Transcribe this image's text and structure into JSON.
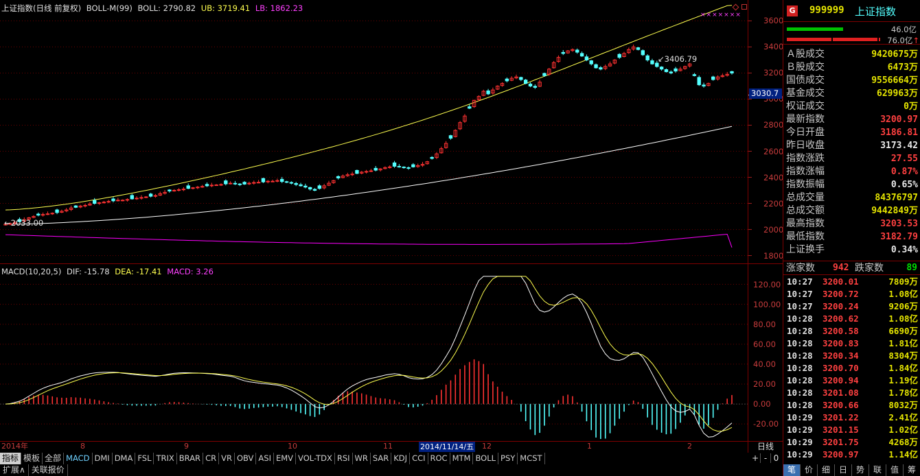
{
  "main_chart": {
    "info": {
      "title": "上证指数(日线 前复权)",
      "indicator": "BOLL-M(99)",
      "boll": "BOLL: 2790.82",
      "ub": "UB: 3719.41",
      "lb": "LB: 1862.23"
    },
    "price_axis_ticks": [
      "3600",
      "3400",
      "3200",
      "3000",
      "2800",
      "2600",
      "2400",
      "2200",
      "2000",
      "1800"
    ],
    "crosshair_price": "3030.7",
    "high_annotation": "3406.79",
    "low_annotation": "2033.00",
    "colors": {
      "up": "#ff3232",
      "down": "#54ffff",
      "mid": "#ffffff",
      "ub": "#ffff4f",
      "lb": "#ff00ff",
      "grid": "#6e0000",
      "axis_text": "#c83c3c"
    }
  },
  "macd_chart": {
    "info": {
      "label": "MACD(10,20,5)",
      "dif": "DIF: -15.78",
      "dea": "DEA: -17.41",
      "macd": "MACD: 3.26"
    },
    "axis_ticks": [
      "120.00",
      "100.00",
      "80.00",
      "60.00",
      "40.00",
      "20.00",
      "0.00",
      "-20.00"
    ]
  },
  "date_axis": {
    "labels": [
      "2014年",
      "8",
      "9",
      "10",
      "11",
      "2014/11/14/五",
      "12",
      "1",
      "2"
    ],
    "period": "日线"
  },
  "indicator_tabs": [
    "指标",
    "模板",
    "全部",
    "MACD",
    "DMI",
    "DMA",
    "FSL",
    "TRIX",
    "BRAR",
    "CR",
    "VR",
    "OBV",
    "ASI",
    "EMV",
    "VOL-TDX",
    "RSI",
    "WR",
    "SAR",
    "KDJ",
    "CCI",
    "ROC",
    "MTM",
    "BOLL",
    "PSY",
    "MCST"
  ],
  "zoom_controls": [
    "+",
    "-",
    "0"
  ],
  "bottom_tabs": [
    "扩展∧",
    "关联报价"
  ],
  "quote_panel": {
    "badge": "G",
    "code": "999999",
    "name": "上证指数",
    "bar1": "46.0亿",
    "bar2": "76.0亿",
    "bar2_arrow": "↑",
    "stats": [
      {
        "label": "Ａ股成交",
        "value": "9420675万",
        "color": "#e5e500"
      },
      {
        "label": "Ｂ股成交",
        "value": "6473万",
        "color": "#e5e500"
      },
      {
        "label": "国债成交",
        "value": "9556664万",
        "color": "#e5e500"
      },
      {
        "label": "基金成交",
        "value": "629963万",
        "color": "#e5e500"
      },
      {
        "label": "权证成交",
        "value": "0万",
        "color": "#e5e500"
      },
      {
        "label": "最新指数",
        "value": "3200.97",
        "color": "#ff4040"
      },
      {
        "label": "今日开盘",
        "value": "3186.81",
        "color": "#ff4040"
      },
      {
        "label": "昨日收盘",
        "value": "3173.42",
        "color": "#e8e8e8"
      },
      {
        "label": "指数涨跌",
        "value": "27.55",
        "color": "#ff4040"
      },
      {
        "label": "指数涨幅",
        "value": "0.87%",
        "color": "#ff4040"
      },
      {
        "label": "指数振幅",
        "value": "0.65%",
        "color": "#e8e8e8"
      },
      {
        "label": "总成交量",
        "value": "84376797",
        "color": "#e5e500"
      },
      {
        "label": "总成交额",
        "value": "9442849万",
        "color": "#e5e500"
      },
      {
        "label": "最高指数",
        "value": "3203.53",
        "color": "#ff4040"
      },
      {
        "label": "最低指数",
        "value": "3182.79",
        "color": "#ff4040"
      },
      {
        "label": "上证换手",
        "value": "0.34%",
        "color": "#e8e8e8"
      }
    ],
    "advance_label": "涨家数",
    "advance_value": "942",
    "decline_label": "跌家数",
    "decline_value": "89",
    "ticks": [
      {
        "time": "10:27",
        "price": "3200.01",
        "vol": "7809万"
      },
      {
        "time": "10:27",
        "price": "3200.72",
        "vol": "1.08亿"
      },
      {
        "time": "10:27",
        "price": "3200.24",
        "vol": "9206万"
      },
      {
        "time": "10:28",
        "price": "3200.62",
        "vol": "1.08亿"
      },
      {
        "time": "10:28",
        "price": "3200.58",
        "vol": "6690万"
      },
      {
        "time": "10:28",
        "price": "3200.83",
        "vol": "1.81亿"
      },
      {
        "time": "10:28",
        "price": "3200.34",
        "vol": "8304万"
      },
      {
        "time": "10:28",
        "price": "3200.70",
        "vol": "1.84亿"
      },
      {
        "time": "10:28",
        "price": "3200.94",
        "vol": "1.19亿"
      },
      {
        "time": "10:28",
        "price": "3201.08",
        "vol": "1.78亿"
      },
      {
        "time": "10:28",
        "price": "3200.66",
        "vol": "8032万"
      },
      {
        "time": "10:29",
        "price": "3201.22",
        "vol": "2.41亿"
      },
      {
        "time": "10:29",
        "price": "3201.15",
        "vol": "1.02亿"
      },
      {
        "time": "10:29",
        "price": "3201.75",
        "vol": "4268万"
      },
      {
        "time": "10:29",
        "price": "3200.97",
        "vol": "1.14亿"
      }
    ],
    "footer_tabs": [
      "笔",
      "价",
      "细",
      "日",
      "势",
      "联",
      "值",
      "筹"
    ]
  },
  "chart_data": [
    {
      "type": "candlestick",
      "title": "上证指数(日线 前复权)",
      "ylim": [
        1740,
        3760
      ],
      "x_start": "2014-07",
      "x_end": "2015-02",
      "close_series": [
        2040,
        2045,
        2055,
        2060,
        2075,
        2090,
        2100,
        2110,
        2115,
        2120,
        2125,
        2130,
        2140,
        2150,
        2165,
        2170,
        2180,
        2185,
        2195,
        2200,
        2205,
        2210,
        2215,
        2220,
        2225,
        2225,
        2230,
        2235,
        2240,
        2245,
        2250,
        2255,
        2260,
        2275,
        2285,
        2295,
        2300,
        2305,
        2310,
        2315,
        2320,
        2325,
        2330,
        2335,
        2340,
        2342,
        2345,
        2350,
        2355,
        2350,
        2345,
        2348,
        2355,
        2360,
        2362,
        2365,
        2370,
        2370,
        2375,
        2368,
        2362,
        2355,
        2345,
        2335,
        2325,
        2310,
        2300,
        2315,
        2335,
        2355,
        2375,
        2395,
        2410,
        2420,
        2425,
        2430,
        2440,
        2445,
        2450,
        2455,
        2465,
        2475,
        2480,
        2485,
        2480,
        2475,
        2470,
        2480,
        2490,
        2500,
        2520,
        2545,
        2580,
        2620,
        2660,
        2700,
        2760,
        2820,
        2870,
        2930,
        2990,
        3020,
        3060,
        3040,
        3070,
        3100,
        3120,
        3140,
        3160,
        3170,
        3150,
        3120,
        3100,
        3090,
        3130,
        3180,
        3230,
        3280,
        3320,
        3350,
        3370,
        3380,
        3360,
        3330,
        3300,
        3270,
        3240,
        3230,
        3250,
        3270,
        3300,
        3320,
        3350,
        3380,
        3400,
        3380,
        3340,
        3300,
        3270,
        3250,
        3230,
        3210,
        3200,
        3215,
        3230,
        3250,
        3270,
        3180,
        3110,
        3100,
        3120,
        3150,
        3170,
        3180,
        3190,
        3200
      ],
      "boll_mid": "2040 → 2790.82",
      "boll_ub": "2150 → 3719.41",
      "boll_lb": "1960 → 1862.23",
      "max_label": 3406.79,
      "min_label": 2033.0
    },
    {
      "type": "line+bar",
      "title": "MACD(10,20,5)",
      "ylim": [
        -35,
        130
      ],
      "dif_last": -15.78,
      "dea_last": -17.41,
      "macd_last": 3.26
    }
  ]
}
